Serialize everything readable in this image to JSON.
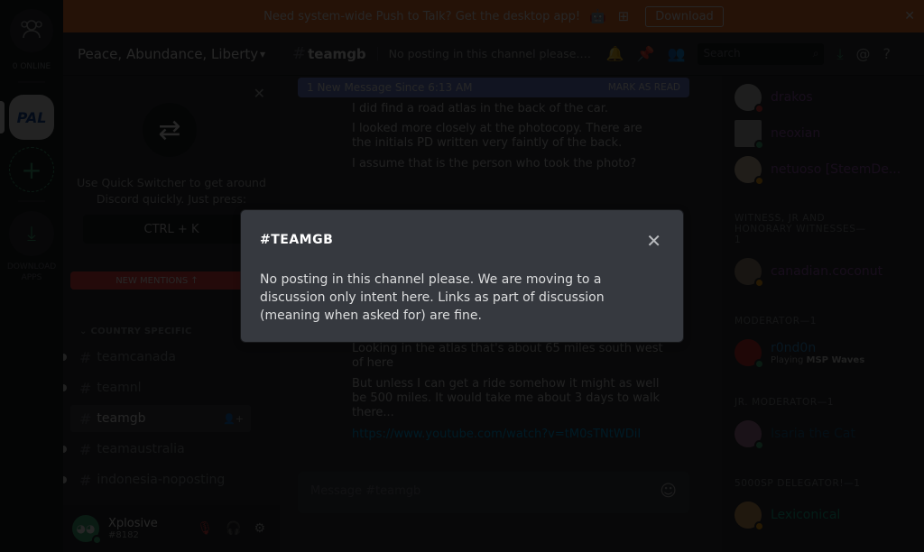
{
  "notice": {
    "text": "Need system-wide Push to Talk? Get the desktop app!",
    "os_icons": " ◆ ⊞",
    "download_label": "Download",
    "close": "✕"
  },
  "rail": {
    "online_label": "0 ONLINE",
    "guild_label": "PAL",
    "download_apps_label": "DOWNLOAD APPS"
  },
  "server": {
    "name": "Peace, Abundance, Liberty",
    "chevron": "⌄"
  },
  "quick_switcher": {
    "text": "Use Quick Switcher to get around Discord quickly. Just press:",
    "shortcut": "CTRL + K",
    "close": "✕"
  },
  "new_mentions": "NEW MENTIONS ↑",
  "category": "COUNTRY SPECIFIC",
  "channels": [
    {
      "name": "teamcanada",
      "unread": true,
      "selected": false
    },
    {
      "name": "teamnl",
      "unread": true,
      "selected": false
    },
    {
      "name": "teamgb",
      "unread": false,
      "selected": true
    },
    {
      "name": "teamaustralia",
      "unread": true,
      "selected": false
    },
    {
      "name": "indonesia-noposting",
      "unread": true,
      "selected": false
    }
  ],
  "user": {
    "name": "Xplosive",
    "tag": "#8182"
  },
  "topbar": {
    "channel": "teamgb",
    "topic": "No posting in this channel please. We...",
    "search_placeholder": "Search"
  },
  "unread_bar": {
    "text": "1 New Message Since 6:13 AM",
    "action": "MARK AS READ"
  },
  "messages": [
    "I did find a road atlas in the back of the car.",
    "I looked more closely at the photocopy. There are the initials PD written very faintly of the back.",
    "I assume that is the person who took the photo?",
    "Looking in the atlas that's about 65 miles south west of here",
    "But unless I can get a ride somehow it might as well be 500 miles. It would take me about 3 days to walk there...",
    "https://www.youtube.com/watch?v=tM0sTNtWDiI"
  ],
  "composer": {
    "placeholder": "Message #teamgb"
  },
  "members": {
    "top": [
      {
        "name": "drakos",
        "status": "dnd",
        "color": "#9b59b6"
      },
      {
        "name": "neoxian",
        "status": "online",
        "color": "#9b59b6"
      },
      {
        "name": "netuoso [SteemDe...",
        "status": "idle",
        "color": "#9b59b6"
      }
    ],
    "groups": [
      {
        "label": "WITNESS, JR AND HONORARY WITNESSES—1",
        "members": [
          {
            "name": "canadian.coconut",
            "status": "idle",
            "color": "#9b59b6"
          }
        ]
      },
      {
        "label": "MODERATOR—1",
        "members": [
          {
            "name": "r0nd0n",
            "status": "online",
            "color": "#3498db",
            "activity_prefix": "Playing",
            "activity": "MSP Waves"
          }
        ]
      },
      {
        "label": "JR. MODERATOR—1",
        "members": [
          {
            "name": "Isaria the Cat",
            "status": "online",
            "color": "#206694"
          }
        ]
      },
      {
        "label": "5000SP DELEGATOR!—1",
        "members": [
          {
            "name": "Lexiconical",
            "status": "idle",
            "color": "#1abc9c"
          }
        ]
      }
    ]
  },
  "modal": {
    "title": "#TEAMGB",
    "body": "No posting in this channel please. We are moving to a discussion only intent here. Links as part of discussion (meaning when asked for) are fine.",
    "close": "✕"
  },
  "status_colors": {
    "online": "#43b581",
    "idle": "#faa61a",
    "dnd": "#f04747"
  }
}
